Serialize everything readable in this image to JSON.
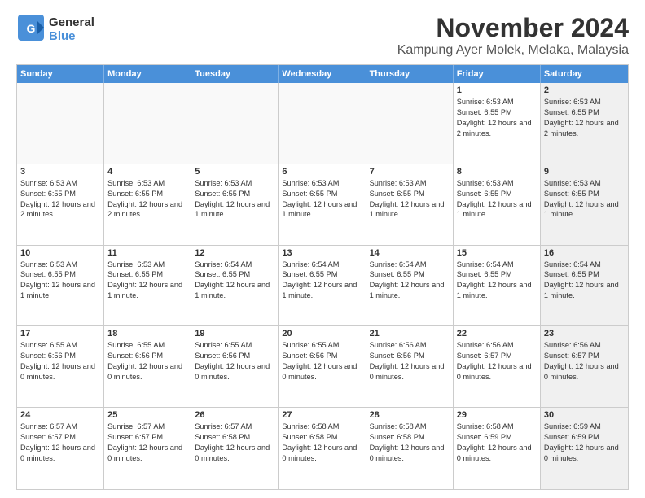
{
  "logo": {
    "line1": "General",
    "line2": "Blue"
  },
  "title": "November 2024",
  "subtitle": "Kampung Ayer Molek, Melaka, Malaysia",
  "header_days": [
    "Sunday",
    "Monday",
    "Tuesday",
    "Wednesday",
    "Thursday",
    "Friday",
    "Saturday"
  ],
  "weeks": [
    [
      {
        "day": "",
        "info": "",
        "shaded": false,
        "empty": true
      },
      {
        "day": "",
        "info": "",
        "shaded": false,
        "empty": true
      },
      {
        "day": "",
        "info": "",
        "shaded": false,
        "empty": true
      },
      {
        "day": "",
        "info": "",
        "shaded": false,
        "empty": true
      },
      {
        "day": "",
        "info": "",
        "shaded": false,
        "empty": true
      },
      {
        "day": "1",
        "info": "Sunrise: 6:53 AM\nSunset: 6:55 PM\nDaylight: 12 hours and 2 minutes.",
        "shaded": false,
        "empty": false
      },
      {
        "day": "2",
        "info": "Sunrise: 6:53 AM\nSunset: 6:55 PM\nDaylight: 12 hours and 2 minutes.",
        "shaded": true,
        "empty": false
      }
    ],
    [
      {
        "day": "3",
        "info": "Sunrise: 6:53 AM\nSunset: 6:55 PM\nDaylight: 12 hours and 2 minutes.",
        "shaded": false,
        "empty": false
      },
      {
        "day": "4",
        "info": "Sunrise: 6:53 AM\nSunset: 6:55 PM\nDaylight: 12 hours and 2 minutes.",
        "shaded": false,
        "empty": false
      },
      {
        "day": "5",
        "info": "Sunrise: 6:53 AM\nSunset: 6:55 PM\nDaylight: 12 hours and 1 minute.",
        "shaded": false,
        "empty": false
      },
      {
        "day": "6",
        "info": "Sunrise: 6:53 AM\nSunset: 6:55 PM\nDaylight: 12 hours and 1 minute.",
        "shaded": false,
        "empty": false
      },
      {
        "day": "7",
        "info": "Sunrise: 6:53 AM\nSunset: 6:55 PM\nDaylight: 12 hours and 1 minute.",
        "shaded": false,
        "empty": false
      },
      {
        "day": "8",
        "info": "Sunrise: 6:53 AM\nSunset: 6:55 PM\nDaylight: 12 hours and 1 minute.",
        "shaded": false,
        "empty": false
      },
      {
        "day": "9",
        "info": "Sunrise: 6:53 AM\nSunset: 6:55 PM\nDaylight: 12 hours and 1 minute.",
        "shaded": true,
        "empty": false
      }
    ],
    [
      {
        "day": "10",
        "info": "Sunrise: 6:53 AM\nSunset: 6:55 PM\nDaylight: 12 hours and 1 minute.",
        "shaded": false,
        "empty": false
      },
      {
        "day": "11",
        "info": "Sunrise: 6:53 AM\nSunset: 6:55 PM\nDaylight: 12 hours and 1 minute.",
        "shaded": false,
        "empty": false
      },
      {
        "day": "12",
        "info": "Sunrise: 6:54 AM\nSunset: 6:55 PM\nDaylight: 12 hours and 1 minute.",
        "shaded": false,
        "empty": false
      },
      {
        "day": "13",
        "info": "Sunrise: 6:54 AM\nSunset: 6:55 PM\nDaylight: 12 hours and 1 minute.",
        "shaded": false,
        "empty": false
      },
      {
        "day": "14",
        "info": "Sunrise: 6:54 AM\nSunset: 6:55 PM\nDaylight: 12 hours and 1 minute.",
        "shaded": false,
        "empty": false
      },
      {
        "day": "15",
        "info": "Sunrise: 6:54 AM\nSunset: 6:55 PM\nDaylight: 12 hours and 1 minute.",
        "shaded": false,
        "empty": false
      },
      {
        "day": "16",
        "info": "Sunrise: 6:54 AM\nSunset: 6:55 PM\nDaylight: 12 hours and 1 minute.",
        "shaded": true,
        "empty": false
      }
    ],
    [
      {
        "day": "17",
        "info": "Sunrise: 6:55 AM\nSunset: 6:56 PM\nDaylight: 12 hours and 0 minutes.",
        "shaded": false,
        "empty": false
      },
      {
        "day": "18",
        "info": "Sunrise: 6:55 AM\nSunset: 6:56 PM\nDaylight: 12 hours and 0 minutes.",
        "shaded": false,
        "empty": false
      },
      {
        "day": "19",
        "info": "Sunrise: 6:55 AM\nSunset: 6:56 PM\nDaylight: 12 hours and 0 minutes.",
        "shaded": false,
        "empty": false
      },
      {
        "day": "20",
        "info": "Sunrise: 6:55 AM\nSunset: 6:56 PM\nDaylight: 12 hours and 0 minutes.",
        "shaded": false,
        "empty": false
      },
      {
        "day": "21",
        "info": "Sunrise: 6:56 AM\nSunset: 6:56 PM\nDaylight: 12 hours and 0 minutes.",
        "shaded": false,
        "empty": false
      },
      {
        "day": "22",
        "info": "Sunrise: 6:56 AM\nSunset: 6:57 PM\nDaylight: 12 hours and 0 minutes.",
        "shaded": false,
        "empty": false
      },
      {
        "day": "23",
        "info": "Sunrise: 6:56 AM\nSunset: 6:57 PM\nDaylight: 12 hours and 0 minutes.",
        "shaded": true,
        "empty": false
      }
    ],
    [
      {
        "day": "24",
        "info": "Sunrise: 6:57 AM\nSunset: 6:57 PM\nDaylight: 12 hours and 0 minutes.",
        "shaded": false,
        "empty": false
      },
      {
        "day": "25",
        "info": "Sunrise: 6:57 AM\nSunset: 6:57 PM\nDaylight: 12 hours and 0 minutes.",
        "shaded": false,
        "empty": false
      },
      {
        "day": "26",
        "info": "Sunrise: 6:57 AM\nSunset: 6:58 PM\nDaylight: 12 hours and 0 minutes.",
        "shaded": false,
        "empty": false
      },
      {
        "day": "27",
        "info": "Sunrise: 6:58 AM\nSunset: 6:58 PM\nDaylight: 12 hours and 0 minutes.",
        "shaded": false,
        "empty": false
      },
      {
        "day": "28",
        "info": "Sunrise: 6:58 AM\nSunset: 6:58 PM\nDaylight: 12 hours and 0 minutes.",
        "shaded": false,
        "empty": false
      },
      {
        "day": "29",
        "info": "Sunrise: 6:58 AM\nSunset: 6:59 PM\nDaylight: 12 hours and 0 minutes.",
        "shaded": false,
        "empty": false
      },
      {
        "day": "30",
        "info": "Sunrise: 6:59 AM\nSunset: 6:59 PM\nDaylight: 12 hours and 0 minutes.",
        "shaded": true,
        "empty": false
      }
    ]
  ]
}
